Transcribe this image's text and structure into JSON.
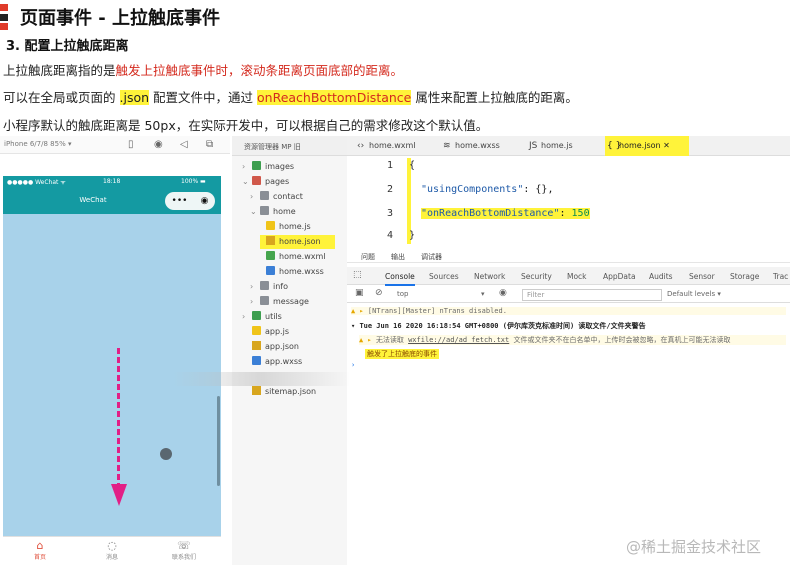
{
  "doc": {
    "title": "页面事件 - 上拉触底事件",
    "title_bar_colors": [
      "#e03b2a",
      "#222222",
      "#e03b2a"
    ],
    "subtitle": "3. 配置上拉触底距离",
    "p1_a": "上拉触底距离指的是",
    "p1_b": "触发上拉触底事件时，滚动条距离页面底部的距离。",
    "p2_a": "可以在全局或页面的",
    "p2_b": ".json",
    "p2_c": "配置文件中，通过",
    "p2_d": "onReachBottomDistance",
    "p2_e": "属性来配置上拉触底的距离。",
    "p3": "小程序默认的触底距离是 50px，在实际开发中，可以根据自己的需求修改这个默认值。"
  },
  "simulator": {
    "model": "iPhone 6/7/8 85% ▾",
    "status_left": "●●●●● WeChat ᯤ",
    "status_time": "18:18",
    "status_right": "100% ▬",
    "nav_title": "WeChat",
    "capsule_more": "•••",
    "capsule_close": "◉",
    "tabs": [
      {
        "label": "首页",
        "icon": "home-icon",
        "glyph": "⌂"
      },
      {
        "label": "消息",
        "icon": "message-icon",
        "glyph": "◌"
      },
      {
        "label": "联系我们",
        "icon": "phone-icon",
        "glyph": "☏"
      }
    ]
  },
  "explorer": {
    "header": "资源管理器 MP 旧",
    "items": [
      {
        "label": "images",
        "type": "folder-green",
        "caret": "›"
      },
      {
        "label": "pages",
        "type": "folder-red",
        "caret": "⌄"
      },
      {
        "label": "contact",
        "type": "folder",
        "caret": "›"
      },
      {
        "label": "home",
        "type": "folder",
        "caret": "⌄"
      },
      {
        "label": "home.js",
        "type": "js",
        "caret": ""
      },
      {
        "label": "home.json",
        "type": "json",
        "caret": ""
      },
      {
        "label": "home.wxml",
        "type": "wxml",
        "caret": ""
      },
      {
        "label": "home.wxss",
        "type": "wxss",
        "caret": ""
      },
      {
        "label": "info",
        "type": "folder",
        "caret": "›"
      },
      {
        "label": "message",
        "type": "folder",
        "caret": "›"
      },
      {
        "label": "utils",
        "type": "folder-green",
        "caret": "›"
      },
      {
        "label": "app.js",
        "type": "js",
        "caret": ""
      },
      {
        "label": "app.json",
        "type": "json",
        "caret": ""
      },
      {
        "label": "app.wxss",
        "type": "wxss",
        "caret": ""
      },
      {
        "label": "sitemap.json",
        "type": "json",
        "caret": ""
      }
    ]
  },
  "editor": {
    "tabs": [
      {
        "label": "home.wxml",
        "glyph": "‹›"
      },
      {
        "label": "home.wxss",
        "glyph": "≋"
      },
      {
        "label": "home.js",
        "glyph": "JS"
      },
      {
        "label": "home.json",
        "glyph": "{ }",
        "close": "✕"
      }
    ],
    "lines": [
      {
        "num": "1",
        "text": "{"
      },
      {
        "num": "2",
        "key": "\"usingComponents\"",
        "rest": ": {},"
      },
      {
        "num": "3",
        "key": "\"onReachBottomDistance\"",
        "rest": ": ",
        "value": "150"
      },
      {
        "num": "4",
        "text": "}"
      }
    ]
  },
  "devtools": {
    "panel_tabs": [
      "问题",
      "输出",
      "调试器"
    ],
    "tabs": [
      "Console",
      "Sources",
      "Network",
      "Security",
      "Mock",
      "AppData",
      "Audits",
      "Sensor",
      "Storage",
      "Trac"
    ],
    "context": "top",
    "filter_placeholder": "Filter",
    "levels": "Default levels ▾",
    "logs": {
      "l1": "[NTrans][Master] nTrans disabled.",
      "l2": "Tue Jun 16 2020 16:18:54 GMT+0800 (伊尔库茨克标准时间) 读取文件/文件夹警告",
      "l3_a": "无法读取",
      "l3_link": "wxfile://ad/ad_fetch.txt",
      "l3_b": "文件或文件夹不在白名单中，上传时会被忽略，在真机上可能无法读取",
      "l4": "触发了上拉触底的事件"
    }
  },
  "watermark": "@稀土掘金技术社区"
}
